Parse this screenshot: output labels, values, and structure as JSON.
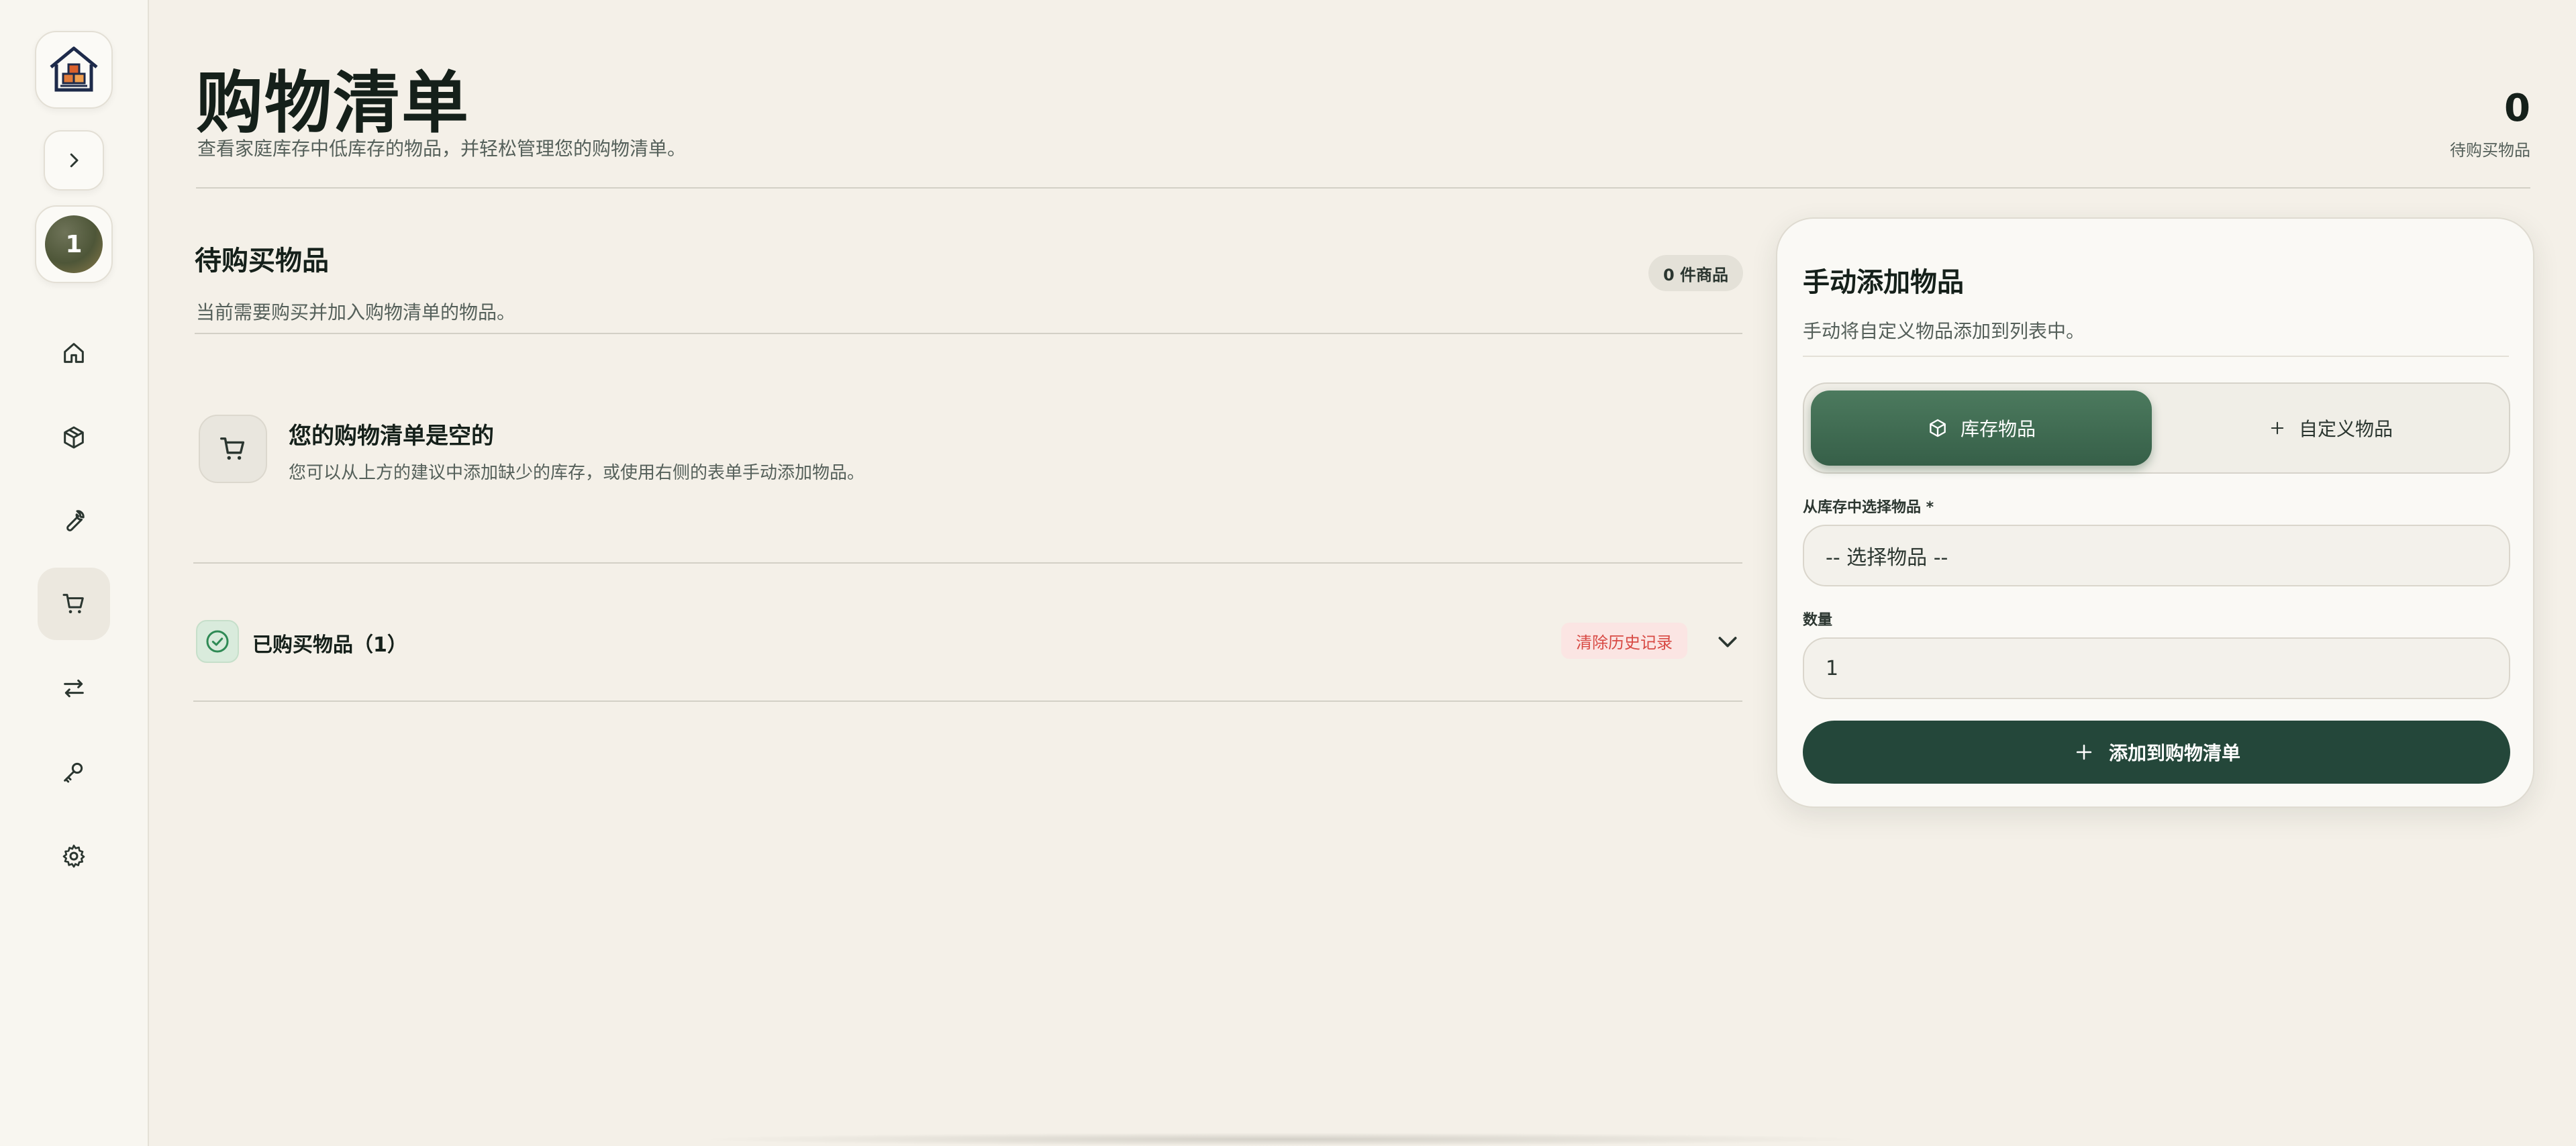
{
  "sidebar": {
    "logo_icon": "house-boxes-icon",
    "toggle_icon": "chevron-right-icon",
    "avatar_text": "1",
    "nav_items": [
      {
        "icon": "home-icon",
        "active": false
      },
      {
        "icon": "box-icon",
        "active": false
      },
      {
        "icon": "wrench-icon",
        "active": false
      },
      {
        "icon": "cart-icon",
        "active": true
      },
      {
        "icon": "transfer-icon",
        "active": false
      },
      {
        "icon": "key-icon",
        "active": false
      },
      {
        "icon": "gear-icon",
        "active": false
      }
    ]
  },
  "header": {
    "title": "购物清单",
    "subtitle": "查看家庭库存中低库存的物品，并轻松管理您的购物清单。",
    "stat_value": "0",
    "stat_label": "待购买物品"
  },
  "pending": {
    "title": "待购买物品",
    "description": "当前需要购买并加入购物清单的物品。",
    "count_badge": "0 件商品",
    "empty_title": "您的购物清单是空的",
    "empty_desc": "您可以从上方的建议中添加缺少的库存，或使用右侧的表单手动添加物品。"
  },
  "purchased": {
    "label": "已购买物品（1）",
    "clear_label": "清除历史记录"
  },
  "manual_add": {
    "title": "手动添加物品",
    "description": "手动将自定义物品添加到列表中。",
    "tab_inventory": "库存物品",
    "tab_custom": "自定义物品",
    "select_label": "从库存中选择物品 *",
    "select_value": "-- 选择物品 --",
    "quantity_label": "数量",
    "quantity_value": "1",
    "submit_label": "添加到购物清单"
  },
  "colors": {
    "accent": "#24473a",
    "background": "#f4f0e8",
    "danger": "#d84a44"
  }
}
